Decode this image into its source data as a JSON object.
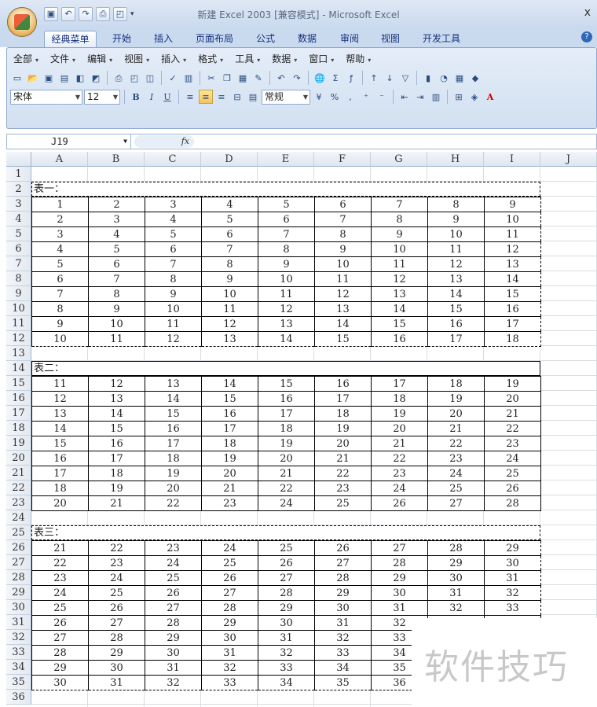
{
  "window": {
    "title": "新建 Excel 2003  [兼容模式] - Microsoft Excel",
    "close_label": "x"
  },
  "ribbon_tabs": [
    "经典菜单",
    "开始",
    "插入",
    "页面布局",
    "公式",
    "数据",
    "审阅",
    "视图",
    "开发工具"
  ],
  "active_tab": "经典菜单",
  "classic_menus": [
    "全部",
    "文件",
    "编辑",
    "视图",
    "插入",
    "格式",
    "工具",
    "数据",
    "窗口",
    "帮助"
  ],
  "font_name": "宋体",
  "font_size": "12",
  "number_format": "常规",
  "name_box": "J19",
  "fx_label": "fx",
  "columns": [
    "A",
    "B",
    "C",
    "D",
    "E",
    "F",
    "G",
    "H",
    "I",
    "J"
  ],
  "rows": [
    "1",
    "2",
    "3",
    "4",
    "5",
    "6",
    "7",
    "8",
    "9",
    "10",
    "11",
    "12",
    "13",
    "14",
    "15",
    "16",
    "17",
    "18",
    "19",
    "20",
    "21",
    "22",
    "23",
    "24",
    "25",
    "26",
    "27",
    "28",
    "29",
    "30",
    "31",
    "32",
    "33",
    "34",
    "35",
    "36"
  ],
  "tables": [
    {
      "caption": "表一：",
      "rows": [
        [
          "1",
          "2",
          "3",
          "4",
          "5",
          "6",
          "7",
          "8",
          "9"
        ],
        [
          "2",
          "3",
          "4",
          "5",
          "6",
          "7",
          "8",
          "9",
          "10"
        ],
        [
          "3",
          "4",
          "5",
          "6",
          "7",
          "8",
          "9",
          "10",
          "11"
        ],
        [
          "4",
          "5",
          "6",
          "7",
          "8",
          "9",
          "10",
          "11",
          "12"
        ],
        [
          "5",
          "6",
          "7",
          "8",
          "9",
          "10",
          "11",
          "12",
          "13"
        ],
        [
          "6",
          "7",
          "8",
          "9",
          "10",
          "11",
          "12",
          "13",
          "14"
        ],
        [
          "7",
          "8",
          "9",
          "10",
          "11",
          "12",
          "13",
          "14",
          "15"
        ],
        [
          "8",
          "9",
          "10",
          "11",
          "12",
          "13",
          "14",
          "15",
          "16"
        ],
        [
          "9",
          "10",
          "11",
          "12",
          "13",
          "14",
          "15",
          "16",
          "17"
        ],
        [
          "10",
          "11",
          "12",
          "13",
          "14",
          "15",
          "16",
          "17",
          "18"
        ]
      ]
    },
    {
      "caption": "表二：",
      "rows": [
        [
          "11",
          "12",
          "13",
          "14",
          "15",
          "16",
          "17",
          "18",
          "19"
        ],
        [
          "12",
          "13",
          "14",
          "15",
          "16",
          "17",
          "18",
          "19",
          "20"
        ],
        [
          "13",
          "14",
          "15",
          "16",
          "17",
          "18",
          "19",
          "20",
          "21"
        ],
        [
          "14",
          "15",
          "16",
          "17",
          "18",
          "19",
          "20",
          "21",
          "22"
        ],
        [
          "15",
          "16",
          "17",
          "18",
          "19",
          "20",
          "21",
          "22",
          "23"
        ],
        [
          "16",
          "17",
          "18",
          "19",
          "20",
          "21",
          "22",
          "23",
          "24"
        ],
        [
          "17",
          "18",
          "19",
          "20",
          "21",
          "22",
          "23",
          "24",
          "25"
        ],
        [
          "18",
          "19",
          "20",
          "21",
          "22",
          "23",
          "24",
          "25",
          "26"
        ],
        [
          "20",
          "21",
          "22",
          "23",
          "24",
          "25",
          "26",
          "27",
          "28"
        ]
      ]
    },
    {
      "caption": "表三：",
      "rows": [
        [
          "21",
          "22",
          "23",
          "24",
          "25",
          "26",
          "27",
          "28",
          "29"
        ],
        [
          "22",
          "23",
          "24",
          "25",
          "26",
          "27",
          "28",
          "29",
          "30"
        ],
        [
          "23",
          "24",
          "25",
          "26",
          "27",
          "28",
          "29",
          "30",
          "31"
        ],
        [
          "24",
          "25",
          "26",
          "27",
          "28",
          "29",
          "30",
          "31",
          "32"
        ],
        [
          "25",
          "26",
          "27",
          "28",
          "29",
          "30",
          "31",
          "32",
          "33"
        ],
        [
          "26",
          "27",
          "28",
          "29",
          "30",
          "31",
          "32",
          "",
          ""
        ],
        [
          "27",
          "28",
          "29",
          "30",
          "31",
          "32",
          "33",
          "",
          ""
        ],
        [
          "28",
          "29",
          "30",
          "31",
          "32",
          "33",
          "34",
          "",
          ""
        ],
        [
          "29",
          "30",
          "31",
          "32",
          "33",
          "34",
          "35",
          "",
          ""
        ],
        [
          "30",
          "31",
          "32",
          "33",
          "34",
          "35",
          "36",
          "",
          ""
        ]
      ]
    }
  ],
  "watermark": "软件技巧"
}
